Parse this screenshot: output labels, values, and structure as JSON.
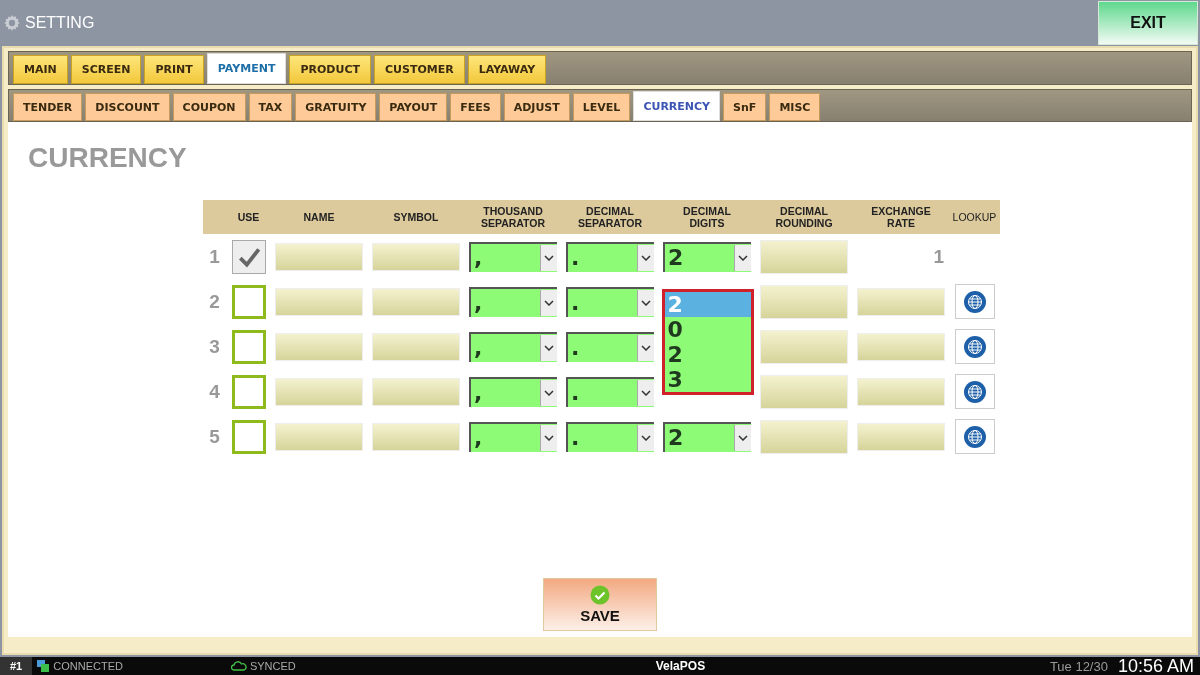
{
  "window": {
    "title": "SETTING",
    "exit_button": "EXIT"
  },
  "tabs": [
    {
      "label": "MAIN",
      "selected": false
    },
    {
      "label": "SCREEN",
      "selected": false
    },
    {
      "label": "PRINT",
      "selected": false
    },
    {
      "label": "PAYMENT",
      "selected": true
    },
    {
      "label": "PRODUCT",
      "selected": false
    },
    {
      "label": "CUSTOMER",
      "selected": false
    },
    {
      "label": "LAYAWAY",
      "selected": false
    }
  ],
  "subtabs": [
    {
      "label": "TENDER",
      "selected": false
    },
    {
      "label": "DISCOUNT",
      "selected": false
    },
    {
      "label": "COUPON",
      "selected": false
    },
    {
      "label": "TAX",
      "selected": false
    },
    {
      "label": "GRATUITY",
      "selected": false
    },
    {
      "label": "PAYOUT",
      "selected": false
    },
    {
      "label": "FEES",
      "selected": false
    },
    {
      "label": "ADJUST",
      "selected": false
    },
    {
      "label": "LEVEL",
      "selected": false
    },
    {
      "label": "CURRENCY",
      "selected": true
    },
    {
      "label": "SnF",
      "selected": false
    },
    {
      "label": "MISC",
      "selected": false
    }
  ],
  "page_title": "CURRENCY",
  "table": {
    "columns": [
      "USE",
      "NAME",
      "SYMBOL",
      "THOUSAND SEPARATOR",
      "DECIMAL SEPARATOR",
      "DECIMAL DIGITS",
      "DECIMAL ROUNDING",
      "EXCHANGE RATE",
      "LOOKUP"
    ],
    "rows": [
      {
        "number": "1",
        "use": true,
        "thousand_separator": ",",
        "decimal_separator": ".",
        "decimal_digits": "2",
        "exchange_rate": "1",
        "lookup": false
      },
      {
        "number": "2",
        "use": false,
        "thousand_separator": ",",
        "decimal_separator": ".",
        "lookup": true
      },
      {
        "number": "3",
        "use": false,
        "thousand_separator": ",",
        "decimal_separator": ".",
        "lookup": true
      },
      {
        "number": "4",
        "use": false,
        "thousand_separator": ",",
        "decimal_separator": ".",
        "lookup": true
      },
      {
        "number": "5",
        "use": false,
        "thousand_separator": ",",
        "decimal_separator": ".",
        "decimal_digits": "2",
        "lookup": true
      }
    ]
  },
  "dropdown": {
    "options": [
      {
        "label": "2",
        "selected": true
      },
      {
        "label": "0",
        "selected": false
      },
      {
        "label": "2",
        "selected": false
      },
      {
        "label": "3",
        "selected": false
      }
    ]
  },
  "save_button": "SAVE",
  "status_bar": {
    "terminal": "#1",
    "connection": "CONNECTED",
    "sync": "SYNCED",
    "app": "VelaPOS",
    "date": "Tue 12/30",
    "time": "10:56 AM"
  }
}
